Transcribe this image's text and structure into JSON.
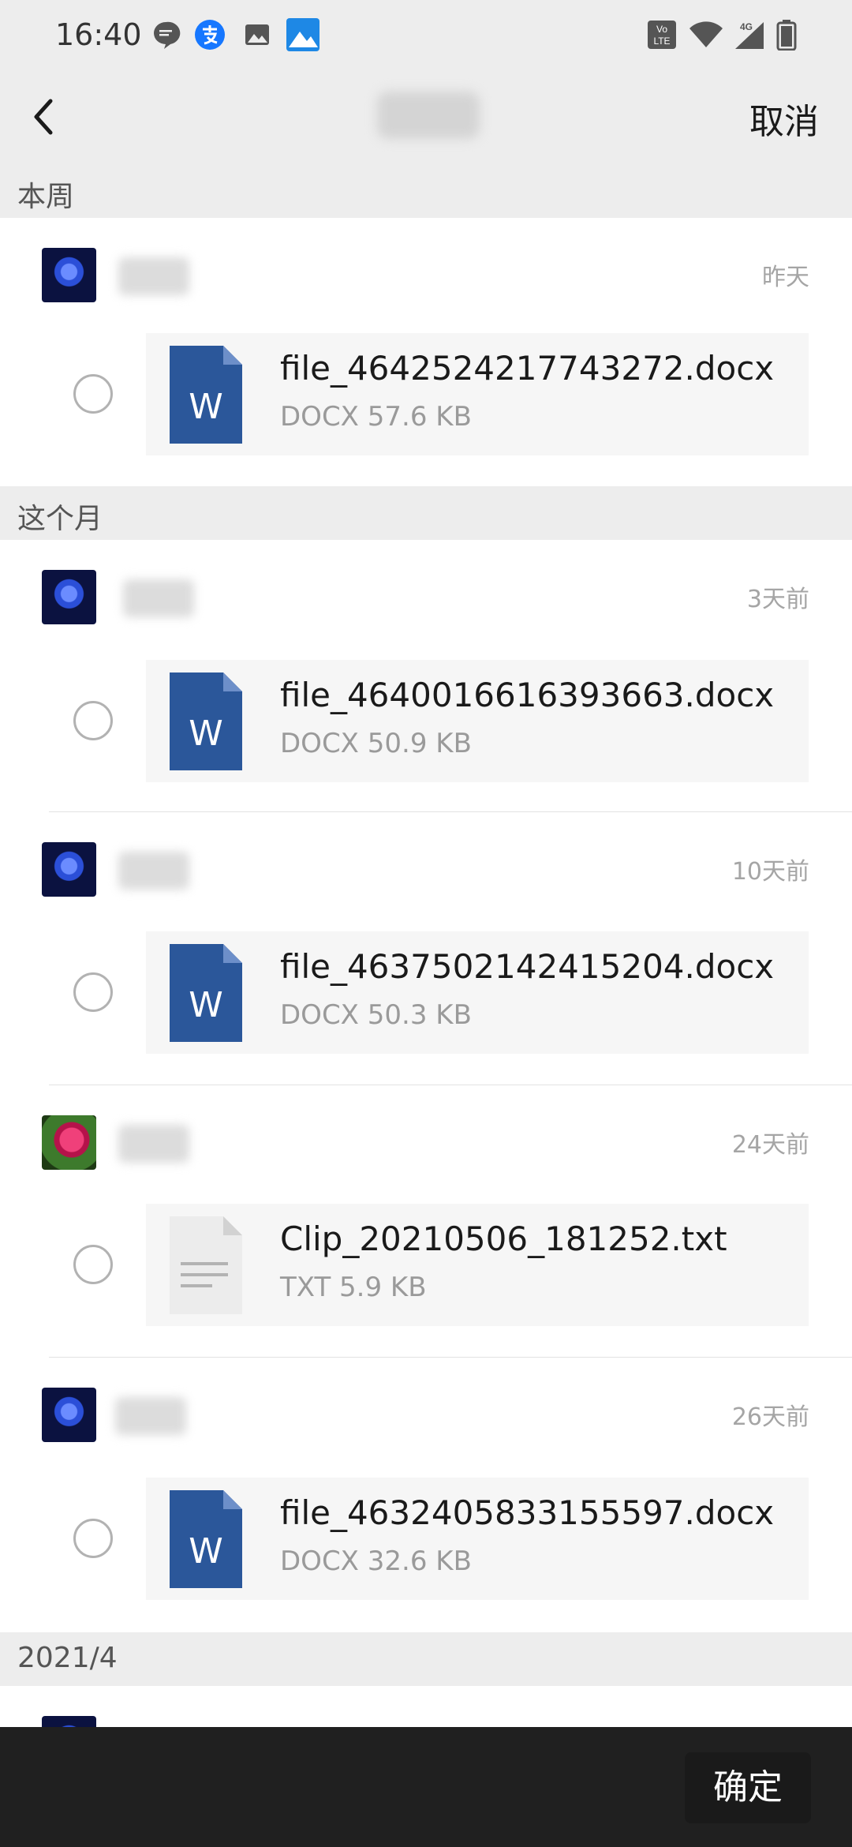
{
  "status_bar": {
    "time": "16:40",
    "icons": [
      "message-icon",
      "alipay-icon",
      "gallery-icon",
      "photos-icon",
      "volte-icon",
      "wifi-icon",
      "signal-4g-icon",
      "battery-icon"
    ],
    "volte_text": "Vo LTE",
    "network_text": "4G"
  },
  "nav": {
    "back_icon": "chevron-left-icon",
    "cancel_label": "取消"
  },
  "sections": [
    {
      "label": "本周",
      "items": [
        {
          "date": "昨天",
          "file_name": "file_4642524217743272.docx",
          "meta": "DOCX 57.6 KB",
          "file_type": "docx"
        }
      ]
    },
    {
      "label": "这个月",
      "items": [
        {
          "date": "3天前",
          "file_name": "file_4640016616393663.docx",
          "meta": "DOCX 50.9 KB",
          "file_type": "docx"
        },
        {
          "date": "10天前",
          "file_name": "file_4637502142415204.docx",
          "meta": "DOCX 50.3 KB",
          "file_type": "docx"
        },
        {
          "date": "24天前",
          "file_name": "Clip_20210506_181252.txt",
          "meta": "TXT 5.9 KB",
          "file_type": "txt"
        },
        {
          "date": "26天前",
          "file_name": "file_4632405833155597.docx",
          "meta": "DOCX 32.6 KB",
          "file_type": "docx"
        }
      ]
    },
    {
      "label": "2021/4",
      "items": []
    }
  ],
  "word_icon_letter": "W",
  "colors": {
    "word_blue": "#2b579a",
    "header_bg": "#ededed",
    "bottom_bar": "#202020"
  },
  "bottom": {
    "confirm_label": "确定"
  }
}
